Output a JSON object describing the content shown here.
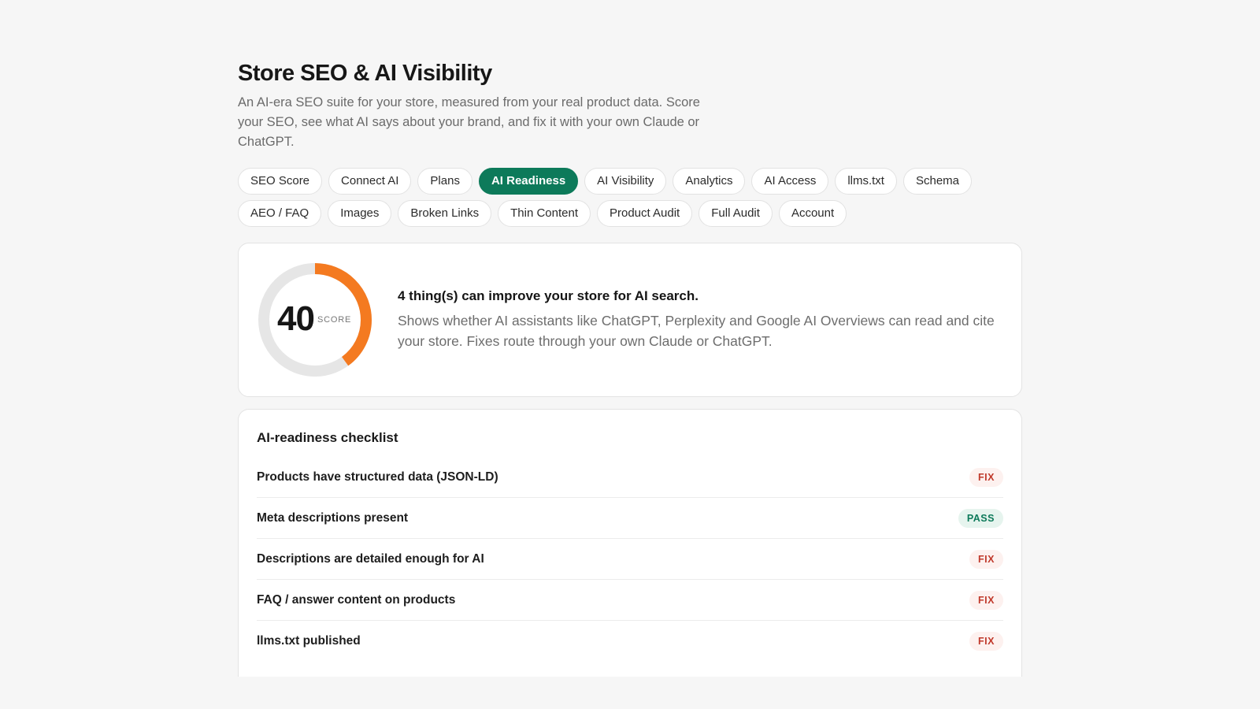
{
  "header": {
    "title": "Store SEO & AI Visibility",
    "subtitle": "An AI-era SEO suite for your store, measured from your real product data. Score your SEO, see what AI says about your brand, and fix it with your own Claude or ChatGPT."
  },
  "tabs": [
    {
      "label": "SEO Score"
    },
    {
      "label": "Connect AI"
    },
    {
      "label": "Plans"
    },
    {
      "label": "AI Readiness",
      "active": true
    },
    {
      "label": "AI Visibility"
    },
    {
      "label": "Analytics"
    },
    {
      "label": "AI Access"
    },
    {
      "label": "llms.txt"
    },
    {
      "label": "Schema"
    },
    {
      "label": "AEO / FAQ"
    },
    {
      "label": "Images"
    },
    {
      "label": "Broken Links"
    },
    {
      "label": "Thin Content"
    },
    {
      "label": "Product Audit"
    },
    {
      "label": "Full Audit"
    },
    {
      "label": "Account"
    }
  ],
  "score": {
    "value": 40,
    "label": "SCORE",
    "fraction": 0.4,
    "heading": "4 thing(s) can improve your store for AI search.",
    "description": "Shows whether AI assistants like ChatGPT, Perplexity and Google AI Overviews can read and cite your store. Fixes route through your own Claude or ChatGPT."
  },
  "checklist": {
    "title": "AI-readiness checklist",
    "items": [
      {
        "label": "Products have structured data (JSON-LD)",
        "status": "FIX"
      },
      {
        "label": "Meta descriptions present",
        "status": "PASS"
      },
      {
        "label": "Descriptions are detailed enough for AI",
        "status": "FIX"
      },
      {
        "label": "FAQ / answer content on products",
        "status": "FIX"
      },
      {
        "label": "llms.txt published",
        "status": "FIX"
      }
    ]
  },
  "colors": {
    "accent": "#0d7a5a",
    "gauge_fill": "#f47a20",
    "gauge_track": "#e6e6e6",
    "fix_text": "#c0392b",
    "pass_text": "#0d7a5a"
  }
}
